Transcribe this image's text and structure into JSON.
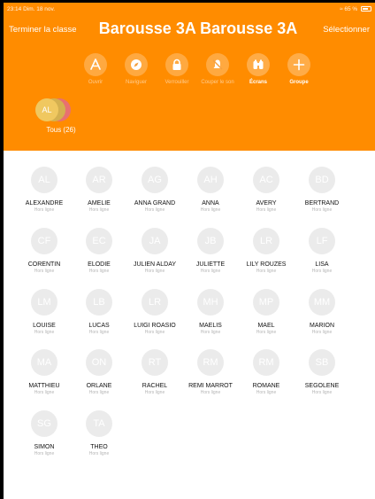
{
  "status": {
    "time_date": "23:14  Dim. 18 nov.",
    "battery": "65 %"
  },
  "header": {
    "end_class": "Terminer la classe",
    "title": "Barousse 3A Barousse 3A",
    "select": "Sélectionner"
  },
  "toolbar": [
    {
      "label": "Ouvrir",
      "icon": "open-app-icon",
      "active": false
    },
    {
      "label": "Naviguer",
      "icon": "compass-icon",
      "active": false
    },
    {
      "label": "Verrouiller",
      "icon": "lock-icon",
      "active": false
    },
    {
      "label": "Couper le son",
      "icon": "mute-icon",
      "active": false
    },
    {
      "label": "Écrans",
      "icon": "binoculars-icon",
      "active": true
    },
    {
      "label": "Groupe",
      "icon": "plus-icon",
      "active": true
    }
  ],
  "group": {
    "avatar_initials": "AL",
    "label": "Tous (26)"
  },
  "students": [
    {
      "initials": "AL",
      "name": "ALEXANDRE",
      "status": "Hors ligne"
    },
    {
      "initials": "AR",
      "name": "AMELIE",
      "status": "Hors ligne"
    },
    {
      "initials": "AG",
      "name": "ANNA GRAND",
      "status": "Hors ligne"
    },
    {
      "initials": "AH",
      "name": "ANNA",
      "status": "Hors ligne"
    },
    {
      "initials": "AC",
      "name": "AVERY",
      "status": "Hors ligne"
    },
    {
      "initials": "BD",
      "name": "BERTRAND",
      "status": "Hors ligne"
    },
    {
      "initials": "CF",
      "name": "CORENTIN",
      "status": "Hors ligne"
    },
    {
      "initials": "EC",
      "name": "ELODIE",
      "status": "Hors ligne"
    },
    {
      "initials": "JA",
      "name": "JULIEN ALDAY",
      "status": "Hors ligne"
    },
    {
      "initials": "JB",
      "name": "JULIETTE",
      "status": "Hors ligne"
    },
    {
      "initials": "LR",
      "name": "LILY ROUZES",
      "status": "Hors ligne"
    },
    {
      "initials": "LF",
      "name": "LISA",
      "status": "Hors ligne"
    },
    {
      "initials": "LM",
      "name": "LOUISE",
      "status": "Hors ligne"
    },
    {
      "initials": "LB",
      "name": "LUCAS",
      "status": "Hors ligne"
    },
    {
      "initials": "LR",
      "name": "LUIGI ROASIO",
      "status": "Hors ligne"
    },
    {
      "initials": "MH",
      "name": "MAELIS",
      "status": "Hors ligne"
    },
    {
      "initials": "MP",
      "name": "MAEL",
      "status": "Hors ligne"
    },
    {
      "initials": "MM",
      "name": "MARION",
      "status": "Hors ligne"
    },
    {
      "initials": "MA",
      "name": "MATTHIEU",
      "status": "Hors ligne"
    },
    {
      "initials": "ON",
      "name": "ORLANE",
      "status": "Hors ligne"
    },
    {
      "initials": "RT",
      "name": "RACHEL",
      "status": "Hors ligne"
    },
    {
      "initials": "RM",
      "name": "REMI MARROT",
      "status": "Hors ligne"
    },
    {
      "initials": "RM",
      "name": "ROMANE",
      "status": "Hors ligne"
    },
    {
      "initials": "SB",
      "name": "SEGOLENE",
      "status": "Hors ligne"
    },
    {
      "initials": "SG",
      "name": "SIMON",
      "status": "Hors ligne"
    },
    {
      "initials": "TA",
      "name": "THEO",
      "status": "Hors ligne"
    }
  ]
}
